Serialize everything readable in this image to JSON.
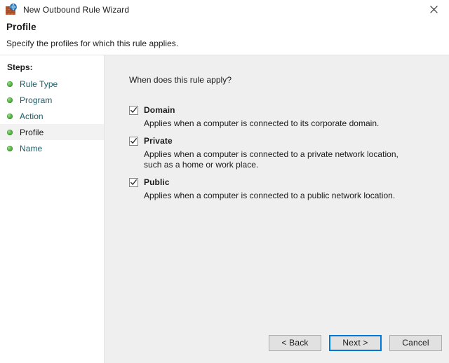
{
  "window": {
    "title": "New Outbound Rule Wizard",
    "icon": "firewall-rule-icon",
    "close_label": "×"
  },
  "header": {
    "title": "Profile",
    "subtitle": "Specify the profiles for which this rule applies."
  },
  "sidebar": {
    "heading": "Steps:",
    "items": [
      {
        "label": "Rule Type",
        "active": false,
        "bullet": "green-bullet-icon"
      },
      {
        "label": "Program",
        "active": false,
        "bullet": "green-bullet-icon"
      },
      {
        "label": "Action",
        "active": false,
        "bullet": "green-bullet-icon"
      },
      {
        "label": "Profile",
        "active": true,
        "bullet": "green-bullet-icon"
      },
      {
        "label": "Name",
        "active": false,
        "bullet": "green-bullet-icon"
      }
    ]
  },
  "main": {
    "question": "When does this rule apply?",
    "options": [
      {
        "label": "Domain",
        "checked": true,
        "description": "Applies when a computer is connected to its corporate domain."
      },
      {
        "label": "Private",
        "checked": true,
        "description": "Applies when a computer is connected to a private network location, such as a home or work place."
      },
      {
        "label": "Public",
        "checked": true,
        "description": "Applies when a computer is connected to a public network location."
      }
    ]
  },
  "buttons": {
    "back": "< Back",
    "next": "Next >",
    "cancel": "Cancel"
  },
  "colors": {
    "panel_background": "#efefef",
    "sidebar_background": "#ffffff",
    "link_text": "#1f5c66",
    "focus_border": "#0078d7",
    "button_face": "#e1e1e1",
    "bullet_green": "#5cb94a"
  }
}
